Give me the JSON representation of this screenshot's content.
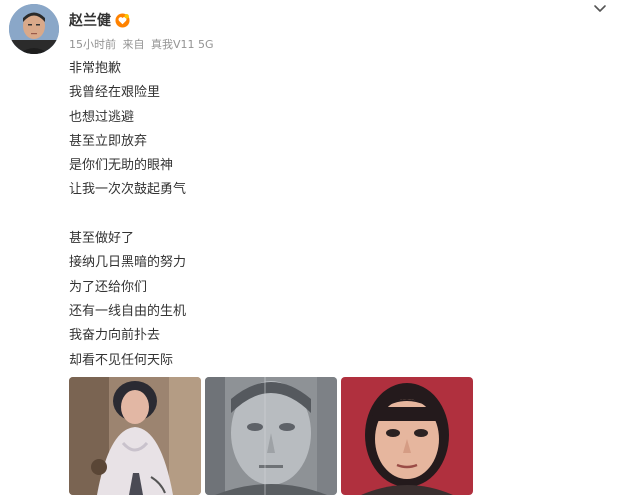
{
  "post": {
    "author": {
      "name": "赵兰健",
      "badge_icon": "vip-heart-badge-icon",
      "avatar_icon": "user-avatar"
    },
    "meta": {
      "time": "15小时前",
      "source_prefix": "来自",
      "device": "真我V11 5G"
    },
    "lines": [
      "非常抱歉",
      "我曾经在艰险里",
      "也想过逃避",
      "甚至立即放弃",
      "是你们无助的眼神",
      "让我一次次鼓起勇气",
      "",
      "甚至做好了",
      "接纳几日黑暗的努力",
      "为了还给你们",
      "还有一线自由的生机",
      "我奋力向前扑去",
      "却看不见任何天际"
    ],
    "photos": [
      {
        "icon": "woman-chained-photo"
      },
      {
        "icon": "grayscale-portrait-photo"
      },
      {
        "icon": "girl-portrait-photo"
      }
    ],
    "more_icon": "chevron-down-icon"
  },
  "colors": {
    "text": "#333333",
    "meta": "#939393",
    "badge": "#ff8200"
  }
}
